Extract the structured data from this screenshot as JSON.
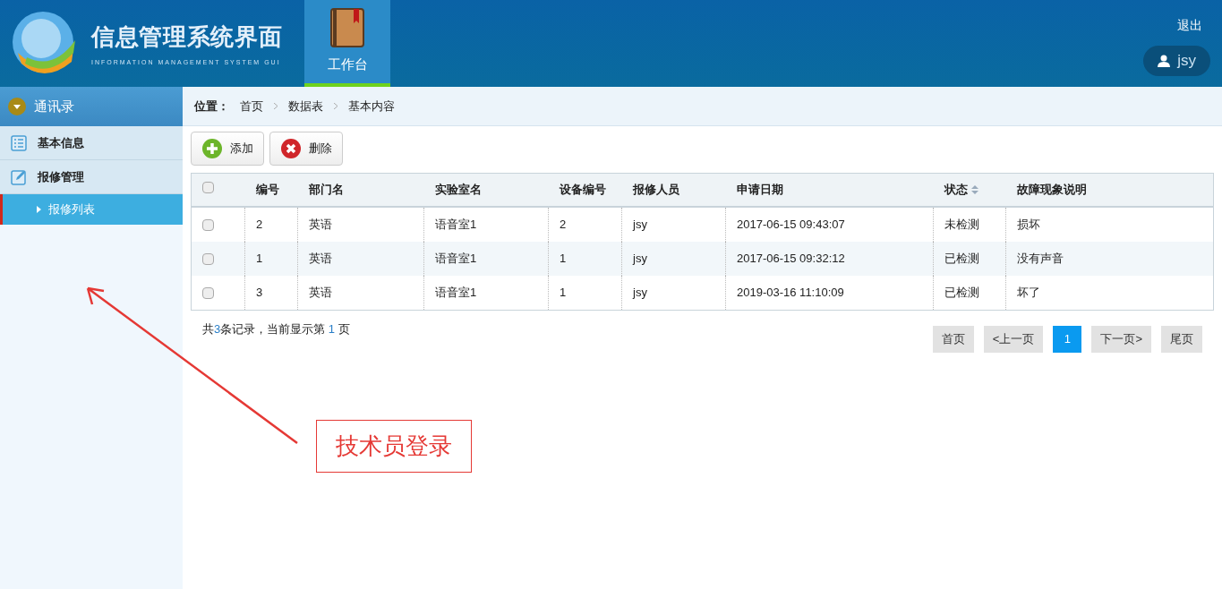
{
  "header": {
    "title": "信息管理系统界面",
    "subtitle": "INFORMATION MANAGEMENT SYSTEM GUI",
    "nav": [
      {
        "label": "工作台",
        "selected": true
      }
    ],
    "logout": "退出",
    "user": "jsy"
  },
  "sidebar": {
    "title": "通讯录",
    "groups": [
      {
        "label": "基本信息",
        "kind": "list"
      },
      {
        "label": "报修管理",
        "kind": "edit",
        "children": [
          {
            "label": "报修列表",
            "selected": true
          }
        ]
      }
    ]
  },
  "breadcrumb": {
    "label": "位置：",
    "items": [
      "首页",
      "数据表",
      "基本内容"
    ]
  },
  "toolbar": [
    {
      "label": "添加",
      "kind": "add"
    },
    {
      "label": "删除",
      "kind": "delete"
    }
  ],
  "table": {
    "header_checked": false,
    "columns": [
      {
        "label": "编号",
        "sortable": false
      },
      {
        "label": "部门名",
        "sortable": false
      },
      {
        "label": "实验室名",
        "sortable": false
      },
      {
        "label": "设备编号",
        "sortable": false
      },
      {
        "label": "报修人员",
        "sortable": false
      },
      {
        "label": "申请日期",
        "sortable": false
      },
      {
        "label": "状态",
        "sortable": true
      },
      {
        "label": "故障现象说明",
        "sortable": false
      }
    ],
    "rows": [
      {
        "checked": false,
        "cells": [
          "2",
          "英语",
          "语音室1",
          "2",
          "jsy",
          "2017-06-15 09:43:07",
          "未检测",
          "损坏"
        ]
      },
      {
        "checked": false,
        "cells": [
          "1",
          "英语",
          "语音室1",
          "1",
          "jsy",
          "2017-06-15 09:32:12",
          "已检测",
          "没有声音"
        ]
      },
      {
        "checked": false,
        "cells": [
          "3",
          "英语",
          "语音室1",
          "1",
          "jsy",
          "2019-03-16 11:10:09",
          "已检测",
          "坏了"
        ]
      }
    ]
  },
  "summary": [
    {
      "text": "共",
      "highlight": false
    },
    {
      "text": "3",
      "highlight": true
    },
    {
      "text": "条记录，当前显示第 ",
      "highlight": false
    },
    {
      "text": "1",
      "highlight": true
    },
    {
      "text": " 页",
      "highlight": false
    }
  ],
  "pagination": [
    {
      "label": "首页",
      "selected": false
    },
    {
      "label": "<上一页",
      "selected": false
    },
    {
      "label": "1",
      "selected": true
    },
    {
      "label": "下一页>",
      "selected": false
    },
    {
      "label": "尾页",
      "selected": false
    }
  ],
  "annotation": {
    "text": "技术员登录"
  }
}
